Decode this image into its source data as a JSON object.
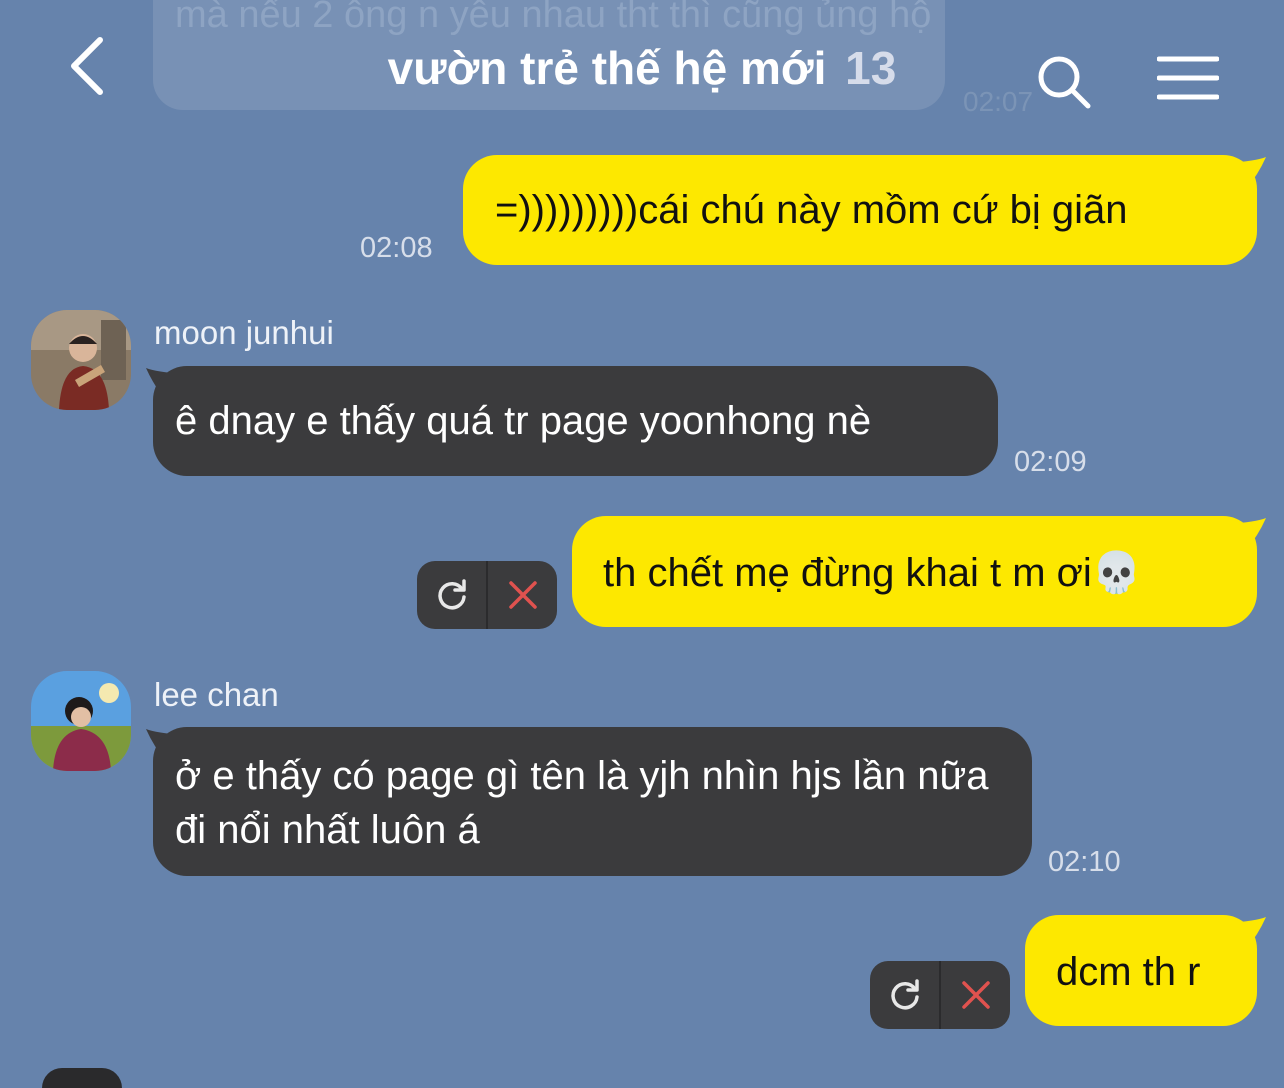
{
  "header": {
    "title": "vườn trẻ thế hệ mới",
    "member_count": "13"
  },
  "previous_message": {
    "text": "mà nếu 2 ông n yêu nhau tht thì cũng ủng hộ",
    "time": "02:07"
  },
  "messages": [
    {
      "sender": "me",
      "text": "=)))))))))cái chú này mồm cứ bị giãn",
      "time": "02:08"
    },
    {
      "sender": "moon junhui",
      "text": "ê dnay e thấy quá tr page yoonhong nè",
      "time": "02:09"
    },
    {
      "sender": "me",
      "text": "th chết mẹ đừng khai t m ơi",
      "emoji": "💀",
      "status": "failed"
    },
    {
      "sender": "lee chan",
      "text": "ở e thấy có page gì tên là yjh nhìn hjs lần nữa đi nổi nhất luôn á",
      "time": "02:10"
    },
    {
      "sender": "me",
      "text": "dcm th r",
      "status": "failed"
    }
  ],
  "colors": {
    "background": "#6683ac",
    "my_bubble": "#fde800",
    "their_bubble": "#3b3b3d",
    "fail_x": "#e0524f"
  },
  "icons": [
    "chevron-left-icon",
    "search-icon",
    "hamburger-menu-icon",
    "retry-icon",
    "close-icon"
  ]
}
